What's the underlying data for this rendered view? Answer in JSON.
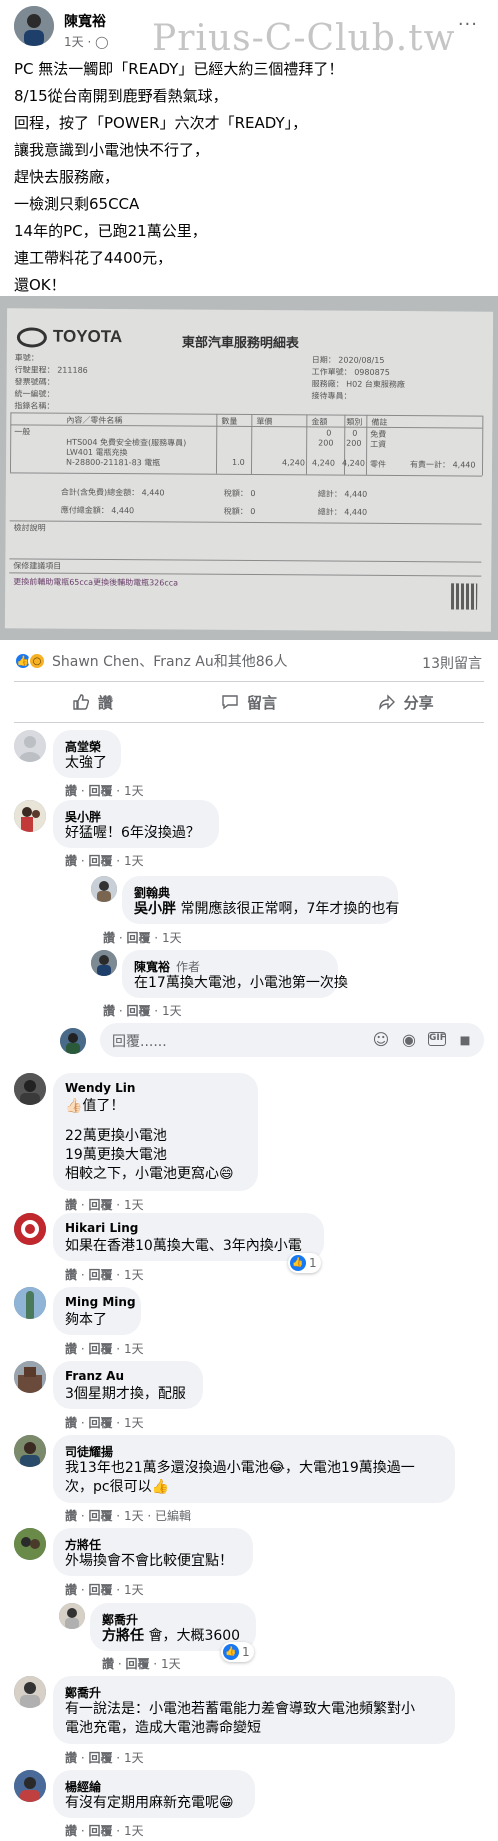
{
  "post": {
    "author": "陳寬裕",
    "time": "1天",
    "privacy_sep": "·",
    "privacy_icon": "globe-icon",
    "watermark": "Prius-C-Club.tw",
    "more_icon": "···",
    "lines": [
      "PC 無法一觸即「READY」已經大約三個禮拜了！",
      "8/15從台南開到鹿野看熱氣球，",
      "回程，按了「POWER」六次才「READY」，",
      "讓我意識到小電池快不行了，",
      "趕快去服務廠，",
      "一檢測只剩65CCA",
      "14年的PC，已跑21萬公里，",
      "連工帶料花了4400元，",
      "還OK！"
    ]
  },
  "receipt": {
    "logo": "TOYOTA",
    "title": "東部汽車服務明細表",
    "rows_left": [
      "車號：",
      "行駛里程：  211186",
      "發票號碼：",
      "統一編號：",
      "指錄名稱："
    ],
    "rows_right": [
      "日期：  2020/08/15",
      "工作單號：  0980875",
      "服務廠：  H02 台東服務廠",
      "接待專員："
    ],
    "col_headers": [
      "內容／零件名稱",
      "數量",
      "單價",
      "金額",
      "類別",
      "備註"
    ],
    "items": [
      [
        "一般",
        "",
        "",
        "0",
        "0",
        "免費"
      ],
      [
        "HTS004  免費安全檢查(服務專員)",
        "",
        "",
        "200",
        "200",
        "工資"
      ],
      [
        "LW401  電瓶充換",
        "",
        "",
        "",
        "",
        ""
      ],
      [
        "N-28800-21181-83  電瓶",
        "1.0",
        "4,240",
        "4,240",
        "4,240",
        "零件"
      ]
    ],
    "payable": "有責一計：  4,440",
    "totals": [
      "合計(含免費)總金額：  4,440",
      "稅額：  0",
      "總計：  4,440",
      "應付總金額：  4,440",
      "稅額：  0",
      "總計：  4,440"
    ],
    "remark_label": "檢討說明",
    "advice_label": "保修建議項目",
    "advice_text": "更換前輔助電瓶65cca更換後輔助電瓶326cca"
  },
  "reactions": {
    "icons": [
      "like-icon",
      "wow-icon"
    ],
    "names": "Shawn Chen、Franz Au和其他86人",
    "comment_count": "13則留言"
  },
  "actions": {
    "like": "讚",
    "comment": "留言",
    "share": "分享"
  },
  "reply_placeholder": "回覆......",
  "meta_like": "讚",
  "meta_reply": "回覆",
  "meta_time": "1天",
  "meta_edited": "已編輯",
  "comments": [
    {
      "name": "高堂榮",
      "lines": [
        "太強了"
      ]
    },
    {
      "name": "吳小胖",
      "lines": [
        "好猛喔！6年沒換過？"
      ]
    },
    {
      "name": "劉翰典",
      "tag": "吳小胖",
      "lines": [
        " 常開應該很正常啊，7年才換的也有"
      ]
    },
    {
      "name": "陳寬裕",
      "badge": "作者",
      "lines": [
        "在17萬換大電池，小電池第一次換"
      ]
    },
    {
      "name": "Wendy Lin",
      "lines": [
        "👍🏻值了！",
        "",
        "22萬更換小電池",
        "19萬更換大電池",
        "相較之下，小電池更窩心😄"
      ]
    },
    {
      "name": "Hikari Ling",
      "lines": [
        "如果在香港10萬換大電、3年內換小電"
      ],
      "likes": "1"
    },
    {
      "name": "Ming Ming",
      "lines": [
        "夠本了"
      ]
    },
    {
      "name": "Franz Au",
      "lines": [
        "3個星期才換，配服"
      ]
    },
    {
      "name": "司徒耀揚",
      "lines": [
        "我13年也21萬多還沒換過小電池😂，大電池19萬換過一",
        "次，pc很可以👍"
      ]
    },
    {
      "name": "方將任",
      "lines": [
        "外場換會不會比較便宜點！"
      ]
    },
    {
      "name": "鄭喬升",
      "tag": "方將任",
      "lines": [
        " 會，大概3600"
      ],
      "likes": "1"
    },
    {
      "name": "鄭喬升",
      "lines": [
        "有一說法是：小電池若蓄電能力差會導致大電池頻繁對小",
        "電池充電，造成大電池壽命變短"
      ]
    },
    {
      "name": "楊經綸",
      "lines": [
        "有沒有定期用麻新充電呢😁"
      ]
    }
  ],
  "colors": {
    "like_blue": "#1877f2",
    "wow_yellow": "#f7b125",
    "bubble": "#f0f2f5",
    "meta_gray": "#65676b"
  }
}
